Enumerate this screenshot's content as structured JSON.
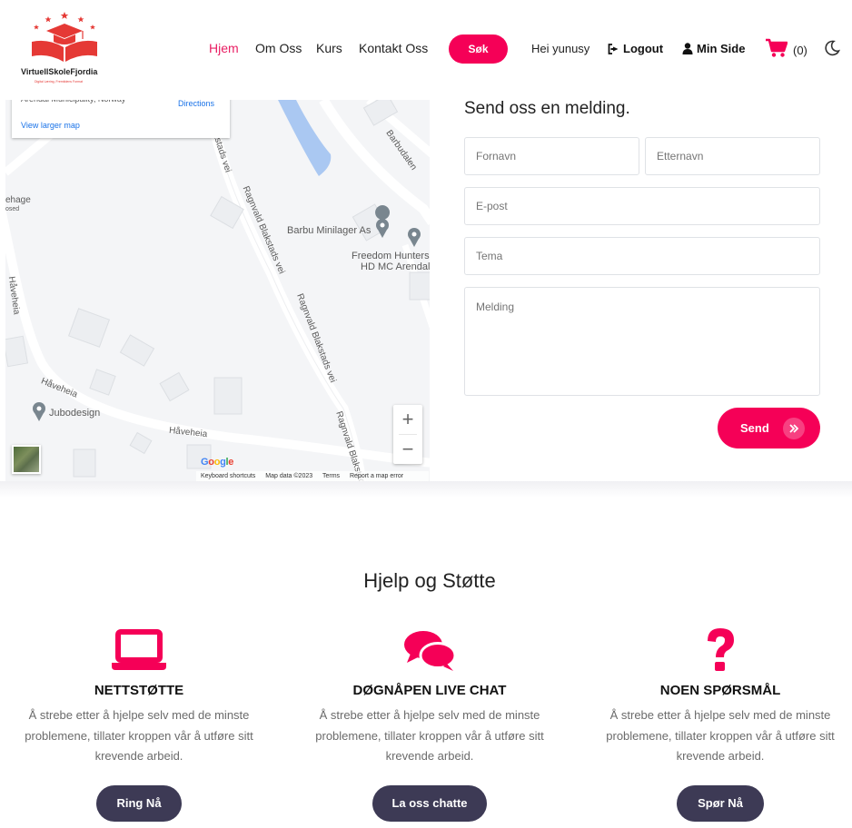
{
  "brand": {
    "name": "VirtuellSkoleFjordia",
    "tagline": "Digital Læring, Fremtidens Format"
  },
  "nav": {
    "items": [
      "Hjem",
      "Om Oss",
      "Kurs",
      "Kontakt Oss"
    ],
    "active": "Hjem",
    "search_label": "Søk",
    "greeting": "Hei yunusy",
    "logout_label": "Logout",
    "profile_label": "Min Side",
    "cart_count": "(0)"
  },
  "map": {
    "address": "Arendal Municipality, Norway",
    "directions_label": "Directions",
    "larger_map_label": "View larger map",
    "labels": {
      "barbudalen": "Barbudalen",
      "ragnvald_1": "Ragnvald Blakstads vei",
      "ragnvald_2": "Ragnvald Blakstads vei",
      "ragnvald_3": "Ragnvald Blakstads",
      "ragnvald_top": "kstads vei",
      "barbu": "Barbu Minilager As",
      "freedom_1": "Freedom Hunters",
      "freedom_2": "HD MC Arendal",
      "haveheia_1": "Håveheia",
      "haveheia_2": "Håveheia",
      "haveheia_3": "Håveheia",
      "jubodesign": "Jubodesign",
      "ehage": "ehage",
      "osed": "osed"
    },
    "zoom_in": "+",
    "zoom_out": "−",
    "google": "Google",
    "attribution": [
      "Keyboard shortcuts",
      "Map data ©2023",
      "Terms",
      "Report a map error"
    ]
  },
  "form": {
    "title": "Send oss en melding.",
    "first_name_placeholder": "Fornavn",
    "last_name_placeholder": "Etternavn",
    "email_placeholder": "E-post",
    "subject_placeholder": "Tema",
    "message_placeholder": "Melding",
    "send_label": "Send"
  },
  "help": {
    "title": "Hjelp og Støtte",
    "columns": [
      {
        "icon": "laptop-icon",
        "heading": "NETTSTØTTE",
        "text": "Å strebe etter å hjelpe selv med de minste problemene, tillater kroppen vår å utføre sitt krevende arbeid.",
        "button": "Ring Nå"
      },
      {
        "icon": "chat-bubbles-icon",
        "heading": "DØGNÅPEN LIVE CHAT",
        "text": "Å strebe etter å hjelpe selv med de minste problemene, tillater kroppen vår å utføre sitt krevende arbeid.",
        "button": "La oss chatte"
      },
      {
        "icon": "question-mark-icon",
        "heading": "NOEN SPØRSMÅL",
        "text": "Å strebe etter å hjelpe selv med de minste problemene, tillater kroppen vår å utføre sitt krevende arbeid.",
        "button": "Spør Nå"
      }
    ]
  },
  "colors": {
    "accent": "#f50057",
    "dark_button": "#3d3a55",
    "link_blue": "#1a73e8"
  }
}
